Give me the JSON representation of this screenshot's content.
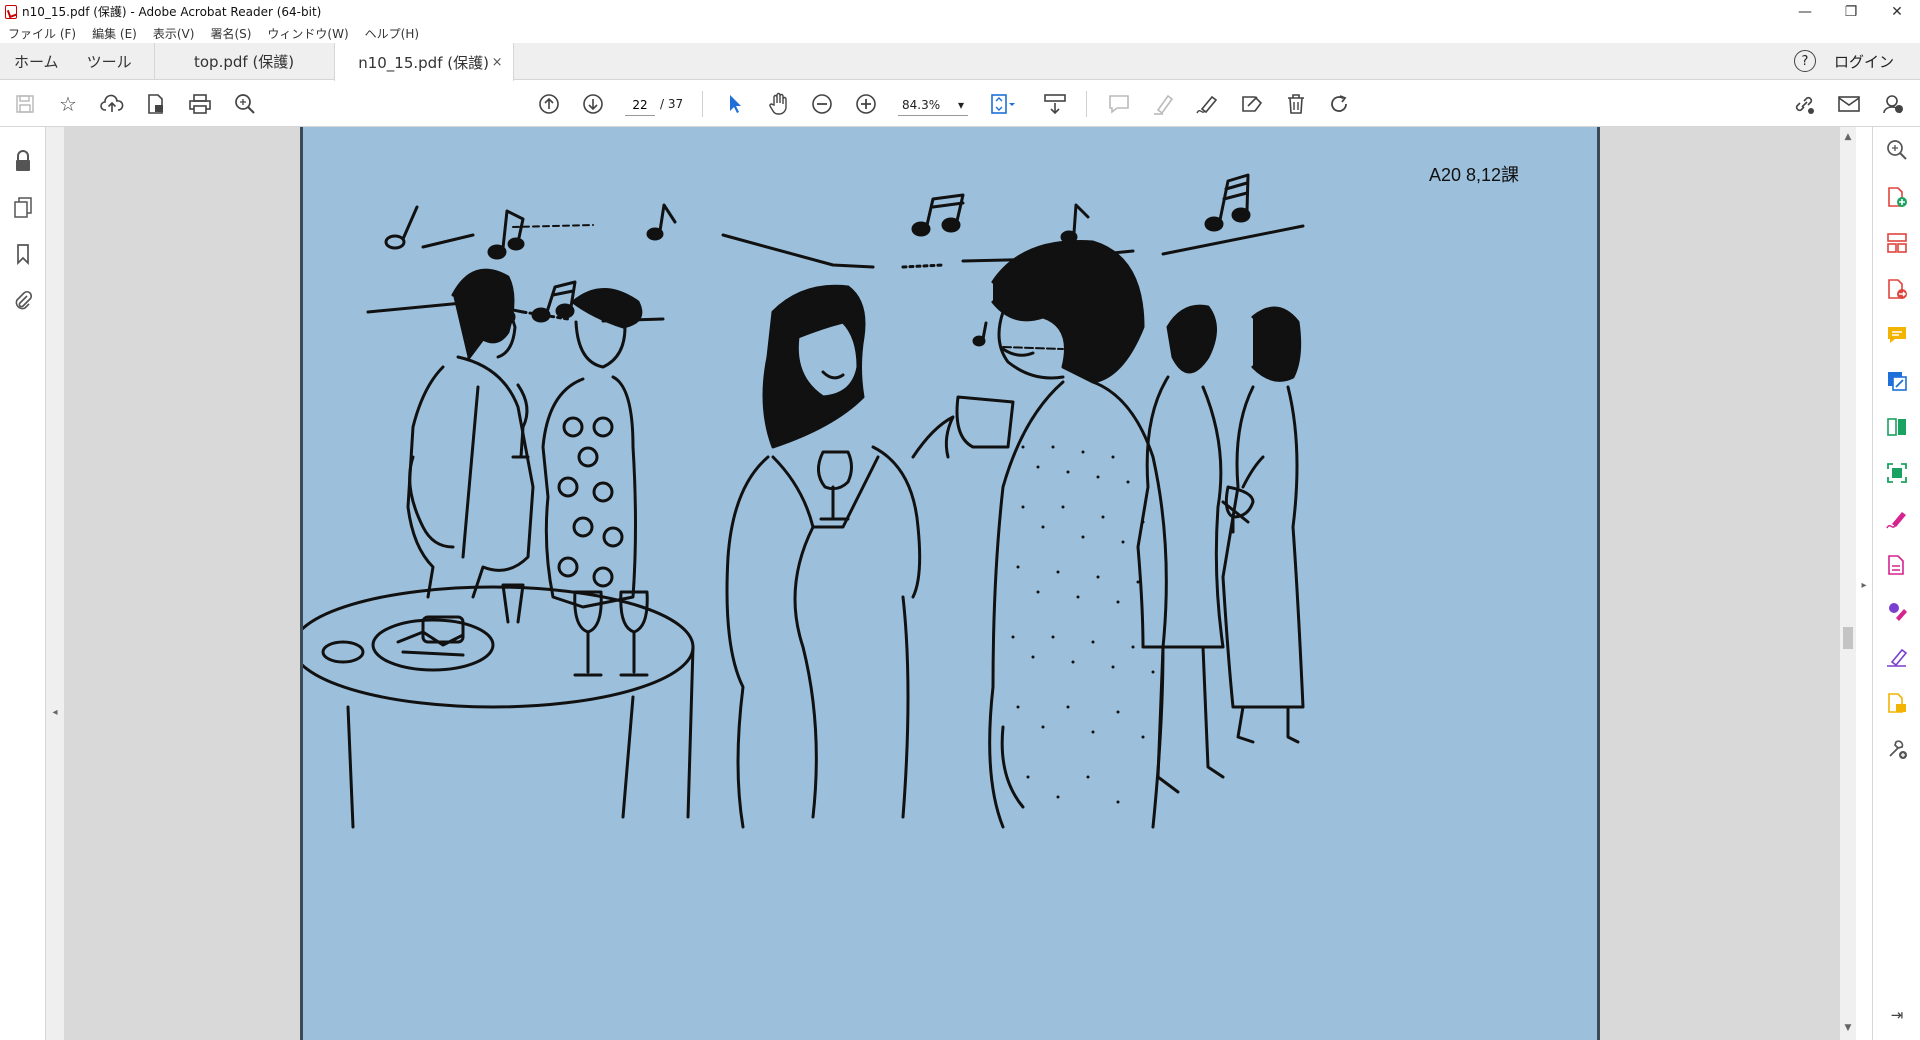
{
  "window": {
    "title": "n10_15.pdf (保護) - Adobe Acrobat Reader (64-bit)",
    "minimize": "—",
    "restore": "❐",
    "close": "✕"
  },
  "menu": [
    "ファイル (F)",
    "編集 (E)",
    "表示(V)",
    "署名(S)",
    "ウィンドウ(W)",
    "ヘルプ(H)"
  ],
  "tabs": {
    "home": "ホーム",
    "tools": "ツール",
    "documents": [
      {
        "label": "top.pdf (保護)",
        "active": false
      },
      {
        "label": "n10_15.pdf (保護)",
        "active": true
      }
    ],
    "close_glyph": "×",
    "help_glyph": "?",
    "login": "ログイン"
  },
  "toolbar": {
    "current_page": "22",
    "total_pages": "/ 37",
    "zoom": "84.3%",
    "zoom_caret": "▾",
    "icons": [
      "save-icon",
      "bookmark-star-icon",
      "upload-cloud-icon",
      "file-lock-icon",
      "print-icon",
      "find-icon",
      "page-up-icon",
      "page-down-icon",
      "select-cursor-icon",
      "hand-icon",
      "zoom-out-icon",
      "zoom-in-icon",
      "fit-page-icon",
      "scroll-mode-icon",
      "comment-icon",
      "highlight-icon",
      "sign-icon",
      "stamp-icon",
      "delete-icon",
      "rotate-icon",
      "share-link-icon",
      "mail-icon",
      "account-icon"
    ]
  },
  "document": {
    "page_label": "A20 8,12課"
  },
  "leftnav": [
    "lock-icon",
    "pages-icon",
    "bookmarks-icon",
    "attachments-icon"
  ],
  "rightpane": {
    "icons": [
      {
        "name": "zoom-search-icon",
        "color": "#555555"
      },
      {
        "name": "create-pdf-icon",
        "color": "#e0443c"
      },
      {
        "name": "organize-pages-icon",
        "color": "#e0443c"
      },
      {
        "name": "export-pdf-icon",
        "color": "#e0443c"
      },
      {
        "name": "comment-tool-icon",
        "color": "#f2b400"
      },
      {
        "name": "edit-pdf-icon",
        "color": "#1e6fd9"
      },
      {
        "name": "compare-icon",
        "color": "#1aa260"
      },
      {
        "name": "scan-ocr-icon",
        "color": "#1aa260"
      },
      {
        "name": "fill-sign-icon",
        "color": "#d6238f"
      },
      {
        "name": "protect-icon",
        "color": "#d6238f"
      },
      {
        "name": "request-signature-icon",
        "color": "#7a3fcf"
      },
      {
        "name": "certificate-icon",
        "color": "#7a3fcf"
      },
      {
        "name": "send-review-icon",
        "color": "#f2b400"
      },
      {
        "name": "more-tools-icon",
        "color": "#555555"
      }
    ],
    "collapse_glyph": "⇥"
  }
}
